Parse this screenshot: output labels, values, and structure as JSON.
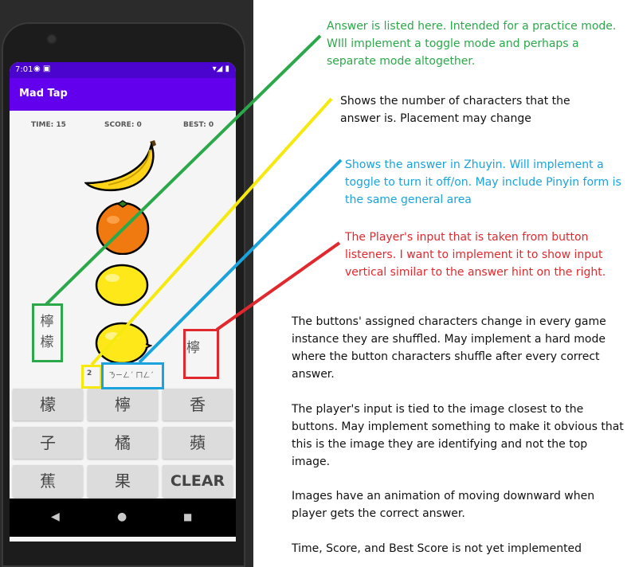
{
  "status_bar": {
    "time": "7:01",
    "left_icons": "◉ ▣",
    "right_icons": "▾◢ ▮"
  },
  "app": {
    "title": "Mad Tap"
  },
  "stats": {
    "time": "TIME: 15",
    "score": "SCORE: 0",
    "best": "BEST: 0"
  },
  "fruits": [
    {
      "name": "banana"
    },
    {
      "name": "orange"
    },
    {
      "name": "lemon"
    },
    {
      "name": "lemon"
    }
  ],
  "answer": {
    "line1": "檸",
    "line2": "檬"
  },
  "player_input": "檸",
  "char_count": "2",
  "zhuyin": "ㄋㄧㄥˊ ㄇㄥˊ",
  "keys": [
    "檬",
    "檸",
    "香",
    "子",
    "橘",
    "蘋",
    "蕉",
    "果",
    "CLEAR"
  ],
  "nav": {
    "back": "◀",
    "home": "●",
    "recents": "■"
  },
  "colors": {
    "app_bar": "#6200ee",
    "status_bar": "#4a04cd",
    "green": "#2aa84a",
    "yellow": "#f5e90e",
    "blue": "#1aa3dc",
    "red": "#e1282d"
  },
  "annotations": {
    "green": "Answer is listed here. Intended for a practice mode. WIll implement a toggle mode and perhaps a separate mode altogether.",
    "yellow": "Shows the number of characters that the answer is. Placement may change",
    "blue": "Shows the answer in Zhuyin. Will implement a toggle to turn it off/on. May include Pinyin form is the same general area",
    "red": "The Player's input that is taken from button listeners. I want to implement it to show input vertical similar to the answer hint on the right.",
    "buttons": "The buttons' assigned characters change in every game instance they are shuffled. May implement a hard mode where the button characters shuffle after every correct answer.",
    "input": "The player's input is tied to the image closest to the buttons. May implement something to make it obvious that this is the image they are identifying and not the top image.",
    "images": "Images have an animation of moving downward when player gets the correct answer.",
    "todo": "Time, Score, and Best Score is not yet implemented"
  }
}
